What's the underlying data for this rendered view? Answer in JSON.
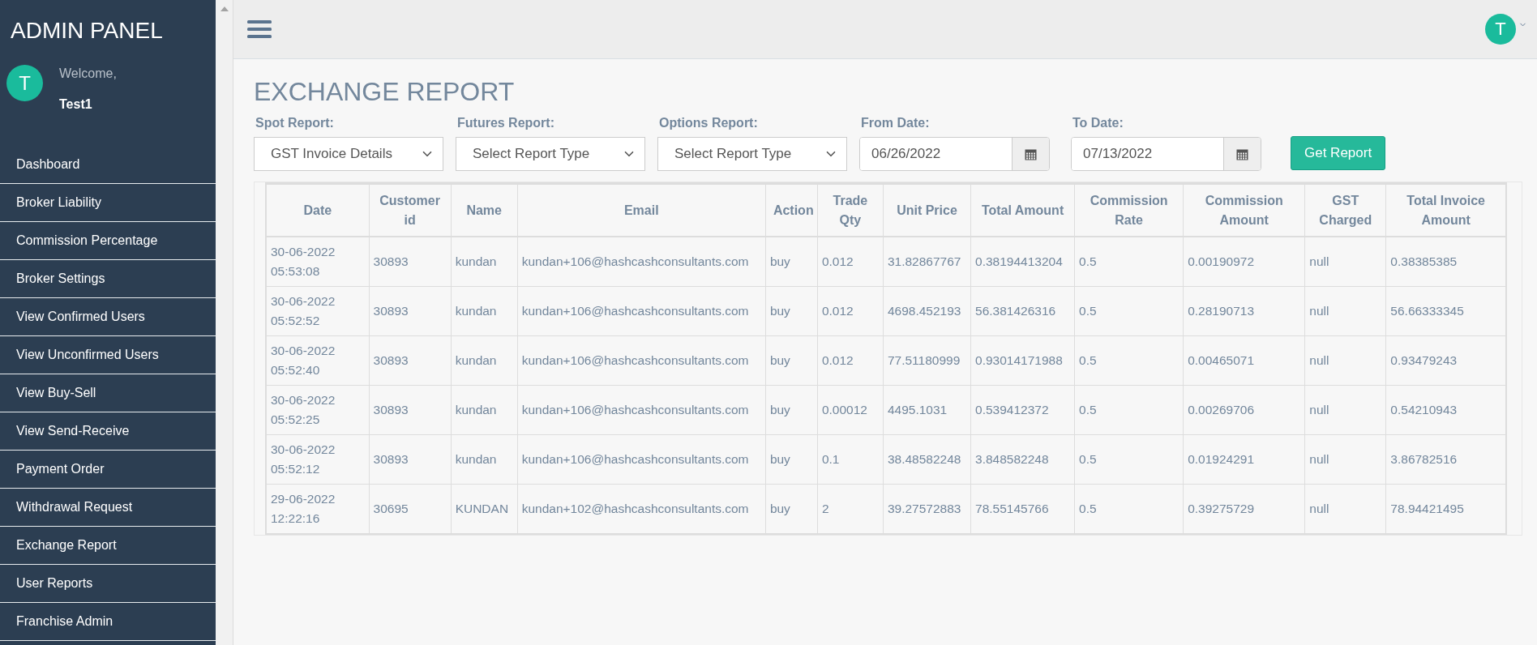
{
  "sidebar": {
    "title": "ADMIN PANEL",
    "user": {
      "avatar_letter": "T",
      "welcome": "Welcome,",
      "name": "Test1"
    },
    "items": [
      {
        "label": "Dashboard"
      },
      {
        "label": "Broker Liability"
      },
      {
        "label": "Commission Percentage"
      },
      {
        "label": "Broker Settings"
      },
      {
        "label": "View Confirmed Users"
      },
      {
        "label": "View Unconfirmed Users"
      },
      {
        "label": "View Buy-Sell"
      },
      {
        "label": "View Send-Receive"
      },
      {
        "label": "Payment Order"
      },
      {
        "label": "Withdrawal Request"
      },
      {
        "label": "Exchange Report"
      },
      {
        "label": "User Reports"
      },
      {
        "label": "Franchise Admin"
      }
    ]
  },
  "header": {
    "avatar_letter": "T"
  },
  "page_title": "EXCHANGE REPORT",
  "filters": [
    {
      "kind": "select",
      "label": "Spot Report:",
      "value": "GST Invoice Details"
    },
    {
      "kind": "select",
      "label": "Futures Report:",
      "value": "Select Report Type"
    },
    {
      "kind": "select",
      "label": "Options Report:",
      "value": "Select Report Type"
    },
    {
      "kind": "date",
      "label": "From Date:",
      "value": "06/26/2022"
    },
    {
      "kind": "date",
      "label": "To Date:",
      "value": "07/13/2022"
    }
  ],
  "submit_button": "Get Report",
  "table": {
    "columns": [
      "Date",
      "Customer id",
      "Name",
      "Email",
      "Action",
      "Trade Qty",
      "Unit Price",
      "Total Amount",
      "Commission Rate",
      "Commission Amount",
      "GST Charged",
      "Total Invoice Amount"
    ],
    "rows": [
      [
        "30-06-2022 05:53:08",
        "30893",
        "kundan",
        "kundan+106@hashcashconsultants.com",
        "buy",
        "0.012",
        "31.82867767",
        "0.38194413204",
        "0.5",
        "0.00190972",
        "null",
        "0.38385385"
      ],
      [
        "30-06-2022 05:52:52",
        "30893",
        "kundan",
        "kundan+106@hashcashconsultants.com",
        "buy",
        "0.012",
        "4698.452193",
        "56.381426316",
        "0.5",
        "0.28190713",
        "null",
        "56.66333345"
      ],
      [
        "30-06-2022 05:52:40",
        "30893",
        "kundan",
        "kundan+106@hashcashconsultants.com",
        "buy",
        "0.012",
        "77.51180999",
        "0.93014171988",
        "0.5",
        "0.00465071",
        "null",
        "0.93479243"
      ],
      [
        "30-06-2022 05:52:25",
        "30893",
        "kundan",
        "kundan+106@hashcashconsultants.com",
        "buy",
        "0.00012",
        "4495.1031",
        "0.539412372",
        "0.5",
        "0.00269706",
        "null",
        "0.54210943"
      ],
      [
        "30-06-2022 05:52:12",
        "30893",
        "kundan",
        "kundan+106@hashcashconsultants.com",
        "buy",
        "0.1",
        "38.48582248",
        "3.848582248",
        "0.5",
        "0.01924291",
        "null",
        "3.86782516"
      ],
      [
        "29-06-2022 12:22:16",
        "30695",
        "KUNDAN",
        "kundan+102@hashcashconsultants.com",
        "buy",
        "2",
        "39.27572883",
        "78.55145766",
        "0.5",
        "0.39275729",
        "null",
        "78.94421495"
      ]
    ]
  }
}
